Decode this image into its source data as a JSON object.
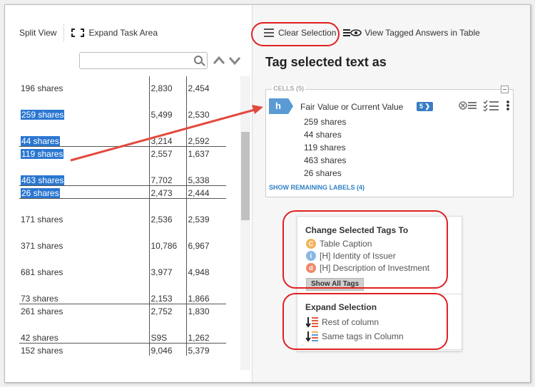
{
  "toolbar_left": {
    "split_view": "Split View",
    "expand_task_area": "Expand Task Area"
  },
  "search": {
    "value": "",
    "placeholder": ""
  },
  "table": {
    "rows": [
      {
        "label": "196 shares",
        "v1": "2,830",
        "v2": "2,454",
        "selected": false
      },
      {
        "label": "259 shares",
        "v1": "5,499",
        "v2": "2,530",
        "selected": true
      },
      {
        "label": "44 shares",
        "v1": "3,214",
        "v2": "2,592",
        "selected": true
      },
      {
        "label": "119 shares",
        "v1": "2,557",
        "v2": "1,637",
        "selected": true
      },
      {
        "label": "463 shares",
        "v1": "7,702",
        "v2": "5,338",
        "selected": true
      },
      {
        "label": "26 shares",
        "v1": "2,473",
        "v2": "2,444",
        "selected": true
      },
      {
        "label": "171 shares",
        "v1": "2,536",
        "v2": "2,539",
        "selected": false
      },
      {
        "label": "371 shares",
        "v1": "10,786",
        "v2": "6,967",
        "selected": false
      },
      {
        "label": "681 shares",
        "v1": "3,977",
        "v2": "4,948",
        "selected": false
      },
      {
        "label": "73 shares",
        "v1": "2,153",
        "v2": "1,866",
        "selected": false
      },
      {
        "label": "261 shares",
        "v1": "2,752",
        "v2": "1,830",
        "selected": false
      },
      {
        "label": "42 shares",
        "v1": "S9S",
        "v2": "1,262",
        "selected": false
      },
      {
        "label": "152 shares",
        "v1": "9,046",
        "v2": "5,379",
        "selected": false
      }
    ]
  },
  "toolbar_right": {
    "clear_selection": "Clear Selection",
    "view_tagged": "View Tagged Answers in Table"
  },
  "panel": {
    "title": "Tag selected text as",
    "cells_label": "CELLS (5)",
    "tag_letter": "h",
    "tag_name": "Fair Value or Current Value",
    "tag_count": "5",
    "values": [
      "259 shares",
      "44 shares",
      "119 shares",
      "463 shares",
      "26 shares"
    ],
    "show_remaining": "SHOW REMAINING LABELS (4)"
  },
  "change_tags": {
    "title": "Change Selected Tags To",
    "items": [
      {
        "letter": "C",
        "label": "Table Caption",
        "color": "#f2b45c"
      },
      {
        "letter": "i",
        "label": "[H] Identity of Issuer",
        "color": "#8ab8e6"
      },
      {
        "letter": "d",
        "label": "[H] Description of Investment",
        "color": "#ef8a6b"
      }
    ],
    "show_all": "Show All Tags"
  },
  "expand_selection": {
    "title": "Expand Selection",
    "items": [
      {
        "label": "Rest of column"
      },
      {
        "label": "Same tags in Column"
      }
    ]
  },
  "colors": {
    "highlight": "#2a77d1",
    "accent_blue": "#3b7dc4",
    "annotation_red": "#e02020"
  }
}
